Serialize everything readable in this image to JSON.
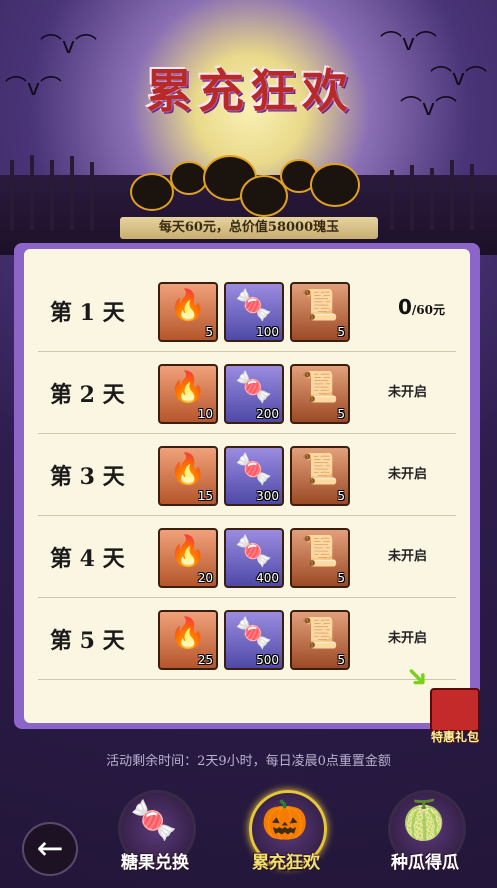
{
  "header": {
    "title": "累充狂欢",
    "subtitle": "每天60元，总价值58000瑰玉"
  },
  "rows": [
    {
      "day": "第 1 天",
      "items": [
        "5",
        "100",
        "5"
      ],
      "progress_value": "0",
      "progress_unit": "/60元",
      "status": ""
    },
    {
      "day": "第 2 天",
      "items": [
        "10",
        "200",
        "5"
      ],
      "progress_value": "",
      "progress_unit": "",
      "status": "未开启"
    },
    {
      "day": "第 3 天",
      "items": [
        "15",
        "300",
        "5"
      ],
      "progress_value": "",
      "progress_unit": "",
      "status": "未开启"
    },
    {
      "day": "第 4 天",
      "items": [
        "20",
        "400",
        "5"
      ],
      "progress_value": "",
      "progress_unit": "",
      "status": "未开启"
    },
    {
      "day": "第 5 天",
      "items": [
        "25",
        "500",
        "5"
      ],
      "progress_value": "",
      "progress_unit": "",
      "status": "未开启"
    }
  ],
  "item_icons": [
    "torch-icon",
    "candy-icon",
    "scroll-icon"
  ],
  "gift": {
    "label": "特惠礼包"
  },
  "timer_text": "活动剩余时间：2天9小时，每日凌晨0点重置金额",
  "tabs": [
    {
      "label": "糖果兑换",
      "icon": "candy-icon",
      "active": false
    },
    {
      "label": "累充狂欢",
      "icon": "pumpkin-icon",
      "active": true
    },
    {
      "label": "种瓜得瓜",
      "icon": "melon-icon",
      "active": false
    }
  ],
  "back_icon": "back-arrow-icon",
  "colors": {
    "panel": "#8b66c8",
    "panel_inner": "#fbf6e2",
    "title": "#b82a2a"
  }
}
